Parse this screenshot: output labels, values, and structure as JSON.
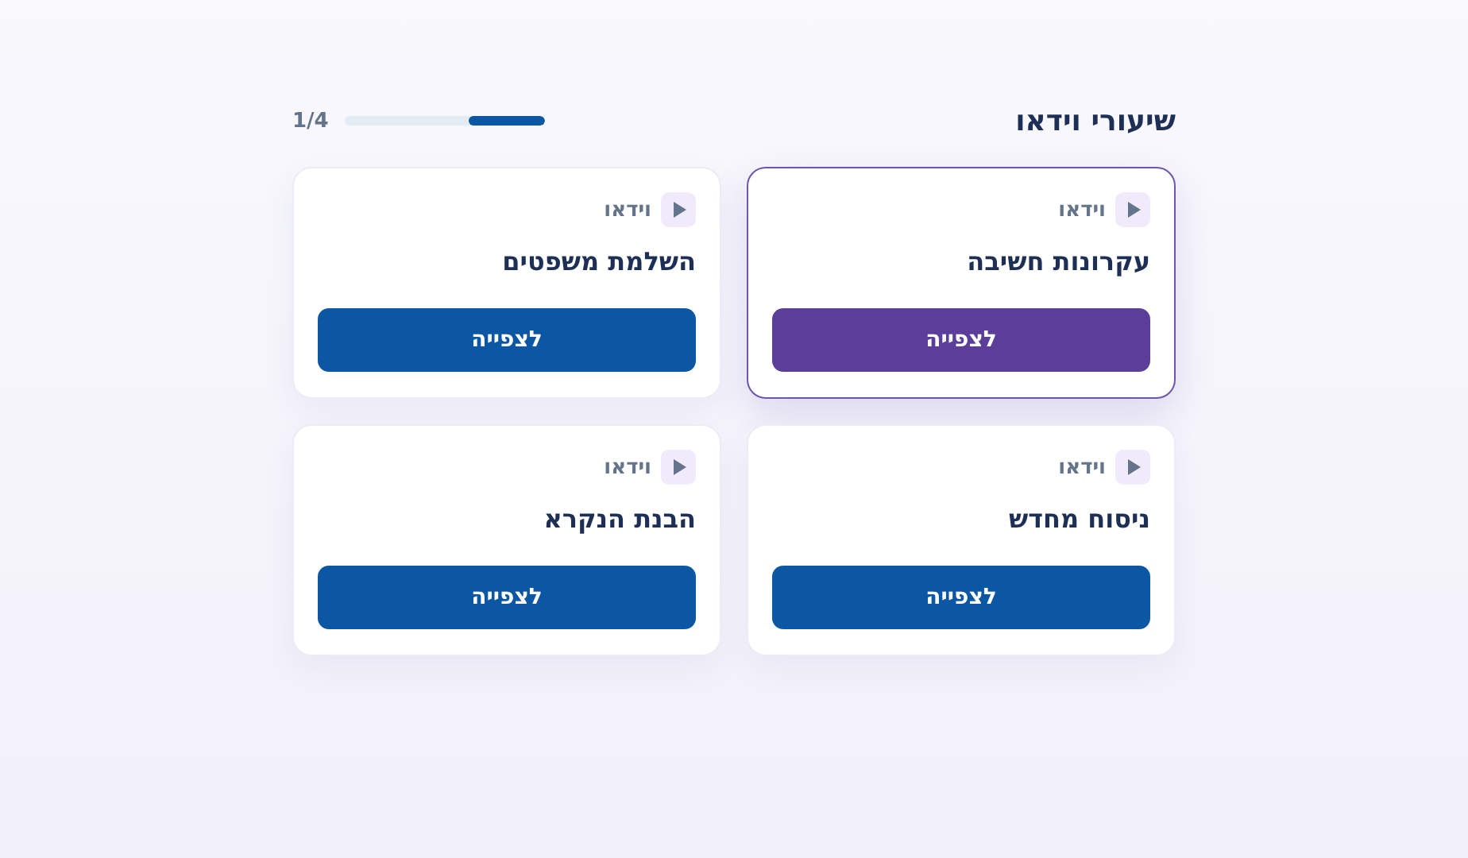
{
  "header": {
    "title": "שיעורי וידאו",
    "counter": "1/4",
    "progress": {
      "level": 0.38
    }
  },
  "lessons": [
    {
      "tag": "וידאו",
      "title": "עקרונות חשיבה",
      "button": "לצפייה",
      "selected": true
    },
    {
      "tag": "וידאו",
      "title": "השלמת משפטים",
      "button": "לצפייה",
      "selected": false
    },
    {
      "tag": "וידאו",
      "title": "ניסוח מחדש",
      "button": "לצפייה",
      "selected": false
    },
    {
      "tag": "וידאו",
      "title": "הבנת הנקרא",
      "button": "לצפייה",
      "selected": false
    }
  ]
}
